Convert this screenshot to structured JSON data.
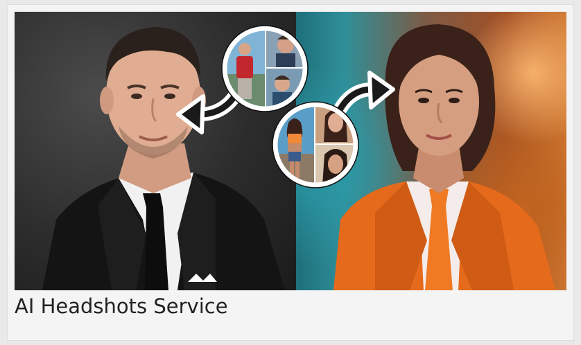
{
  "card": {
    "title": "AI Headshots Service"
  },
  "hero": {
    "left_portrait": "man-in-suit-headshot",
    "right_portrait": "woman-in-orange-suit-headshot",
    "left_input_photos": "man-casual-selfies",
    "right_input_photos": "woman-casual-selfies",
    "arrow_icon": "curved-arrow-icon"
  },
  "colors": {
    "left_background": "#2c2c2c",
    "right_accent": "#e0651a",
    "badge_border": "#ffffff"
  }
}
